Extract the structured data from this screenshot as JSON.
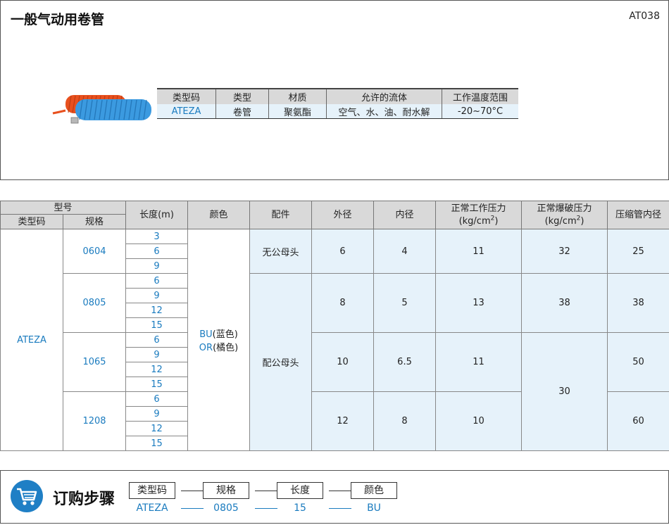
{
  "header": {
    "title": "一般气动用卷管",
    "code": "AT038"
  },
  "summary": {
    "headers": [
      "类型码",
      "类型",
      "材质",
      "允许的流体",
      "工作温度范围"
    ],
    "row": [
      "ATEZA",
      "卷管",
      "聚氨酯",
      "空气、水、油、耐水解",
      "-20~70°C"
    ]
  },
  "spec": {
    "header": {
      "model_group": "型号",
      "type_code": "类型码",
      "spec": "规格",
      "length": "长度(m)",
      "color": "颜色",
      "fitting": "配件",
      "outer_dia": "外径",
      "inner_dia": "内径",
      "work_pressure": "正常工作压力",
      "burst_pressure": "正常爆破压力",
      "pressure_unit": "(kg/cm",
      "pressure_unit_sup": "2",
      "pressure_unit_end": ")",
      "shrink_inner": "压缩管内径"
    },
    "type_code": "ATEZA",
    "color_bu_code": "BU",
    "color_bu_name": "(蓝色)",
    "color_or_code": "OR",
    "color_or_name": "(橘色)",
    "fitting_none": "无公母头",
    "fitting_with": "配公母头",
    "groups": [
      {
        "spec": "0604",
        "lengths": [
          "3",
          "6",
          "9"
        ],
        "outer": "6",
        "inner": "4",
        "work": "11",
        "burst": "32",
        "shrink": "25"
      },
      {
        "spec": "0805",
        "lengths": [
          "6",
          "9",
          "12",
          "15"
        ],
        "outer": "8",
        "inner": "5",
        "work": "13",
        "burst": "38",
        "shrink": "38"
      },
      {
        "spec": "1065",
        "lengths": [
          "6",
          "9",
          "12",
          "15"
        ],
        "outer": "10",
        "inner": "6.5",
        "work": "11",
        "burst": "30",
        "shrink": "50"
      },
      {
        "spec": "1208",
        "lengths": [
          "6",
          "9",
          "12",
          "15"
        ],
        "outer": "12",
        "inner": "8",
        "work": "10",
        "burst": "30",
        "shrink": "60"
      }
    ]
  },
  "order": {
    "title": "订购步骤",
    "icon": "shopping-cart-icon",
    "steps": [
      {
        "label": "类型码",
        "value": "ATEZA"
      },
      {
        "label": "规格",
        "value": "0805"
      },
      {
        "label": "长度",
        "value": "15"
      },
      {
        "label": "颜色",
        "value": "BU"
      }
    ]
  },
  "colors": {
    "accent": "#1a7bbf",
    "header_bg": "#d9d9d9",
    "cell_bg": "#e6f2fa",
    "hose_orange": "#e8501e",
    "hose_blue": "#3b9ae0"
  }
}
